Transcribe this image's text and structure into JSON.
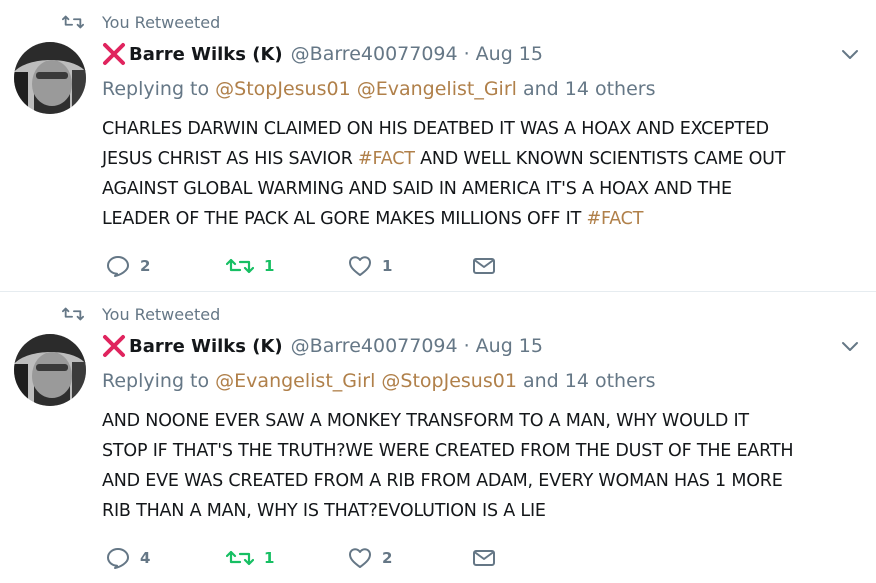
{
  "colors": {
    "muted": "#657786",
    "text": "#14171a",
    "link": "#b0804a",
    "retweet_active": "#17bf63",
    "x_mark": "#e0245e",
    "divider": "#e6ecf0"
  },
  "tweets": [
    {
      "context": "You Retweeted",
      "author": {
        "display_name": "Barre Wilks (K)",
        "handle": "@Barre40077094",
        "date": "Aug 15",
        "dot": "·",
        "name_prefix_icon": "red-x-icon"
      },
      "replying": {
        "prefix": "Replying to",
        "mentions": [
          "@StopJesus01",
          "@Evangelist_Girl"
        ],
        "others": "and 14 others"
      },
      "text_lines": [
        [
          "CHARLES DARWIN CLAIMED ON HIS DEATBED IT WAS A HOAX AND EXCEPTED"
        ],
        [
          "JESUS CHRIST AS HIS SAVIOR ",
          "#FACT",
          " AND WELL KNOWN SCIENTISTS CAME OUT"
        ],
        [
          "AGAINST GLOBAL WARMING AND SAID IN AMERICA IT'S A HOAX AND THE"
        ],
        [
          "LEADER OF THE PACK AL GORE MAKES MILLIONS OFF IT ",
          "#FACT"
        ]
      ],
      "actions": {
        "replies": "2",
        "retweets": "1",
        "likes": "1"
      }
    },
    {
      "context": "You Retweeted",
      "author": {
        "display_name": "Barre Wilks (K)",
        "handle": "@Barre40077094",
        "date": "Aug 15",
        "dot": "·",
        "name_prefix_icon": "red-x-icon"
      },
      "replying": {
        "prefix": "Replying to",
        "mentions": [
          "@Evangelist_Girl",
          "@StopJesus01"
        ],
        "others": "and 14 others"
      },
      "text_lines": [
        [
          "AND NOONE EVER SAW A MONKEY TRANSFORM TO A MAN, WHY WOULD IT"
        ],
        [
          "STOP IF THAT'S THE TRUTH?WE WERE CREATED FROM THE DUST OF THE EARTH"
        ],
        [
          "AND EVE WAS CREATED FROM A RIB FROM ADAM, EVERY WOMAN HAS 1 MORE"
        ],
        [
          "RIB THAN A MAN, WHY IS THAT?EVOLUTION IS A LIE"
        ]
      ],
      "actions": {
        "replies": "4",
        "retweets": "1",
        "likes": "2"
      }
    }
  ]
}
